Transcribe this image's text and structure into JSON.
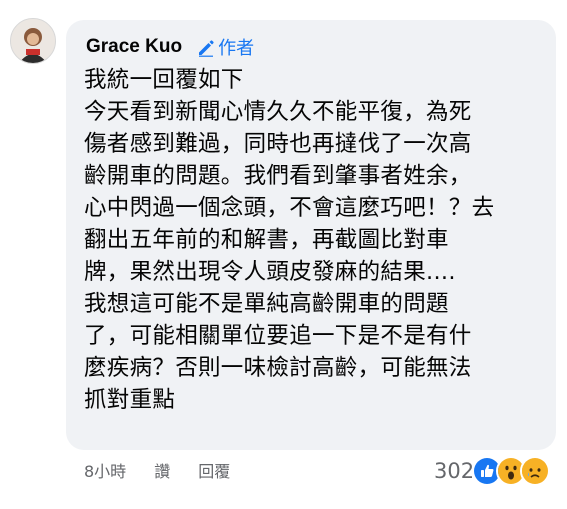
{
  "comment": {
    "author": "Grace Kuo",
    "author_badge": "作者",
    "lines": [
      "我統一回覆如下",
      "今天看到新聞心情久久不能平復，為死",
      "傷者感到難過，同時也再撻伐了一次高",
      "齡開車的問題。我們看到肇事者姓余，",
      "心中閃過一個念頭，不會這麼巧吧！？去",
      "翻出五年前的和解書，再截圖比對車",
      "牌，果然出現令人頭皮發麻的結果....",
      "我想這可能不是單純高齡開車的問題",
      "了，可能相關單位要追一下是不是有什",
      "麼疾病？否則一味檢討高齡，可能無法",
      "抓對重點"
    ]
  },
  "meta": {
    "time": "8小時",
    "like_label": "讚",
    "reply_label": "回覆"
  },
  "reactions": {
    "count": "302",
    "icons": [
      "like-reaction-icon",
      "wow-reaction-icon",
      "sad-reaction-icon"
    ],
    "colors": {
      "like": "#1877f2",
      "wow": "#f7b125",
      "sad": "#f7b125"
    }
  },
  "colors": {
    "bubble": "#f0f2f5",
    "accent": "#1877f2",
    "text": "#050505",
    "muted": "#65676b"
  }
}
